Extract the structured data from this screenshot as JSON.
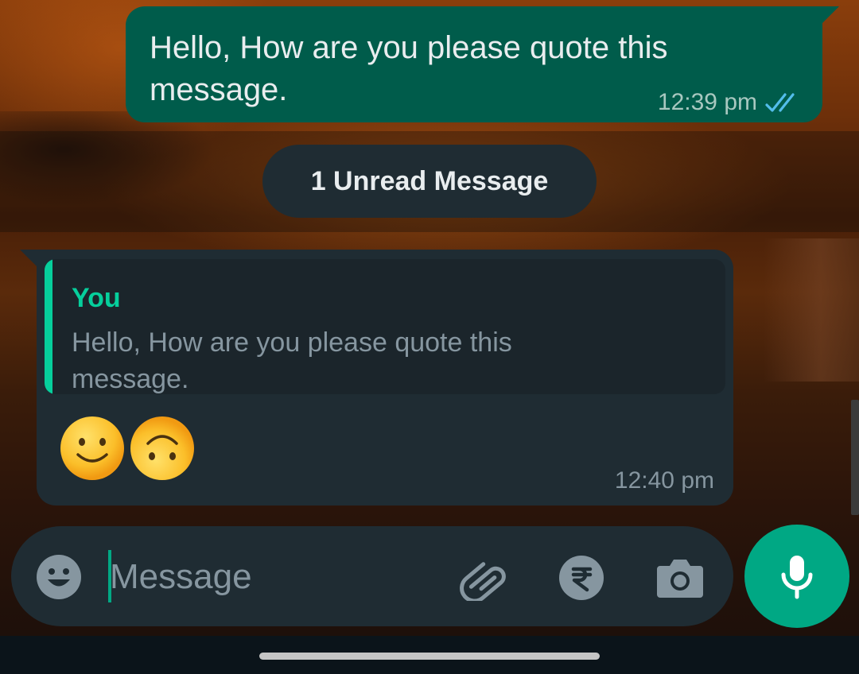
{
  "chat": {
    "outgoing_message": {
      "text": "Hello, How are you please quote this message.",
      "time": "12:39 pm",
      "status_icon": "double-check-read-icon"
    },
    "unread_divider": {
      "label": "1 Unread Message"
    },
    "incoming_message": {
      "quoted": {
        "author": "You",
        "text": "Hello, How are you please quote this message."
      },
      "emojis": [
        "slightly-smiling-face",
        "upside-down-face"
      ],
      "time": "12:40 pm"
    }
  },
  "composer": {
    "placeholder": "Message",
    "value": "",
    "icons": {
      "left": "emoji-icon",
      "attach": "paperclip-icon",
      "payment": "rupee-icon",
      "camera": "camera-icon",
      "send": "microphone-icon"
    }
  },
  "colors": {
    "outgoing_bubble": "#005c4b",
    "incoming_bubble": "#1f2c33",
    "accent": "#00a884",
    "quote_author": "#06cf9c",
    "read_ticks": "#53bdeb"
  }
}
